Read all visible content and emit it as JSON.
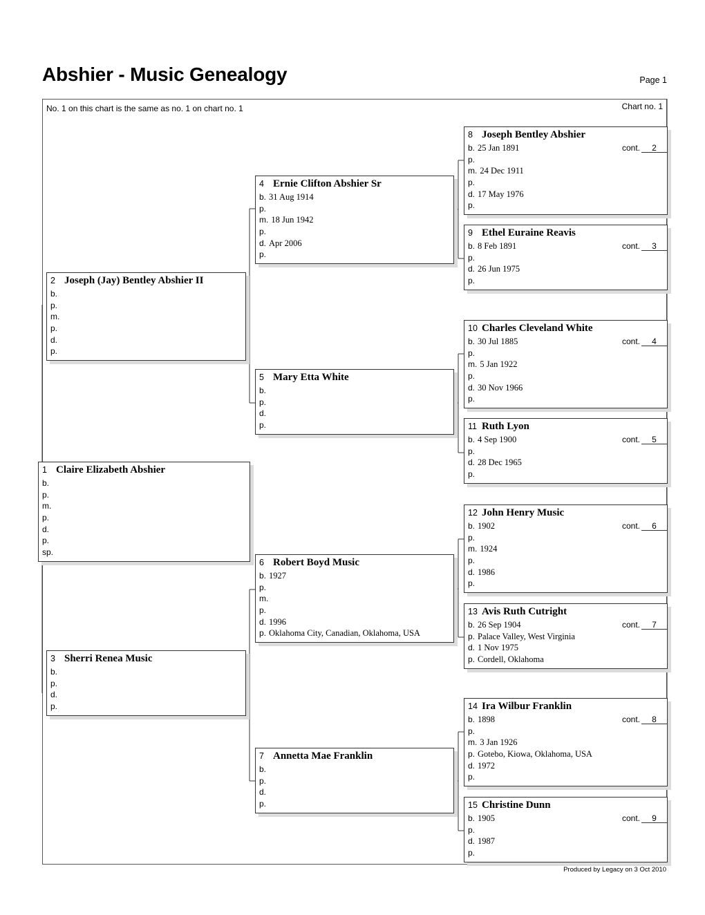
{
  "header": {
    "title": "Abshier - Music Genealogy",
    "page_label": "Page 1"
  },
  "chart": {
    "note": "No. 1 on this chart is the same as no. 1 on chart no. 1",
    "chart_no": "Chart no. 1"
  },
  "footer": "Produced by Legacy on 3 Oct 2010",
  "labels": {
    "cont": "cont."
  },
  "people": {
    "p1": {
      "num": "1",
      "name": "Claire Elizabeth Abshier",
      "rows": [
        {
          "l": "b.",
          "v": ""
        },
        {
          "l": "p.",
          "v": ""
        },
        {
          "l": "m.",
          "v": ""
        },
        {
          "l": "p.",
          "v": ""
        },
        {
          "l": "d.",
          "v": ""
        },
        {
          "l": "p.",
          "v": ""
        },
        {
          "l": "sp.",
          "v": ""
        }
      ]
    },
    "p2": {
      "num": "2",
      "name": "Joseph (Jay) Bentley Abshier II",
      "rows": [
        {
          "l": "b.",
          "v": ""
        },
        {
          "l": "p.",
          "v": ""
        },
        {
          "l": "m.",
          "v": ""
        },
        {
          "l": "p.",
          "v": ""
        },
        {
          "l": "d.",
          "v": ""
        },
        {
          "l": "p.",
          "v": ""
        }
      ]
    },
    "p3": {
      "num": "3",
      "name": "Sherri Renea Music",
      "rows": [
        {
          "l": "b.",
          "v": ""
        },
        {
          "l": "p.",
          "v": ""
        },
        {
          "l": "d.",
          "v": ""
        },
        {
          "l": "p.",
          "v": ""
        }
      ]
    },
    "p4": {
      "num": "4",
      "name": "Ernie Clifton Abshier Sr",
      "rows": [
        {
          "l": "b.",
          "v": "31 Aug 1914"
        },
        {
          "l": "p.",
          "v": ""
        },
        {
          "l": "m.",
          "v": "18 Jun 1942"
        },
        {
          "l": "p.",
          "v": ""
        },
        {
          "l": "d.",
          "v": "Apr 2006"
        },
        {
          "l": "p.",
          "v": ""
        }
      ]
    },
    "p5": {
      "num": "5",
      "name": "Mary Etta White",
      "rows": [
        {
          "l": "b.",
          "v": ""
        },
        {
          "l": "p.",
          "v": ""
        },
        {
          "l": "d.",
          "v": ""
        },
        {
          "l": "p.",
          "v": ""
        }
      ]
    },
    "p6": {
      "num": "6",
      "name": "Robert Boyd Music",
      "rows": [
        {
          "l": "b.",
          "v": "1927"
        },
        {
          "l": "p.",
          "v": ""
        },
        {
          "l": "m.",
          "v": ""
        },
        {
          "l": "p.",
          "v": ""
        },
        {
          "l": "d.",
          "v": "1996"
        },
        {
          "l": "p.",
          "v": "Oklahoma City, Canadian, Oklahoma, USA"
        }
      ]
    },
    "p7": {
      "num": "7",
      "name": "Annetta Mae Franklin",
      "rows": [
        {
          "l": "b.",
          "v": ""
        },
        {
          "l": "p.",
          "v": ""
        },
        {
          "l": "d.",
          "v": ""
        },
        {
          "l": "p.",
          "v": ""
        }
      ]
    },
    "p8": {
      "num": "8",
      "name": "Joseph Bentley Abshier",
      "cont": "2",
      "rows": [
        {
          "l": "b.",
          "v": "25 Jan 1891"
        },
        {
          "l": "p.",
          "v": ""
        },
        {
          "l": "m.",
          "v": "24 Dec 1911"
        },
        {
          "l": "p.",
          "v": ""
        },
        {
          "l": "d.",
          "v": "17 May 1976"
        },
        {
          "l": "p.",
          "v": ""
        }
      ]
    },
    "p9": {
      "num": "9",
      "name": "Ethel Euraine Reavis",
      "cont": "3",
      "rows": [
        {
          "l": "b.",
          "v": "8 Feb 1891"
        },
        {
          "l": "p.",
          "v": ""
        },
        {
          "l": "d.",
          "v": "26 Jun 1975"
        },
        {
          "l": "p.",
          "v": ""
        }
      ]
    },
    "p10": {
      "num": "10",
      "name": "Charles Cleveland White",
      "cont": "4",
      "rows": [
        {
          "l": "b.",
          "v": "30 Jul 1885"
        },
        {
          "l": "p.",
          "v": ""
        },
        {
          "l": "m.",
          "v": "5 Jan 1922"
        },
        {
          "l": "p.",
          "v": ""
        },
        {
          "l": "d.",
          "v": "30 Nov 1966"
        },
        {
          "l": "p.",
          "v": ""
        }
      ]
    },
    "p11": {
      "num": "11",
      "name": "Ruth Lyon",
      "cont": "5",
      "rows": [
        {
          "l": "b.",
          "v": "4 Sep 1900"
        },
        {
          "l": "p.",
          "v": ""
        },
        {
          "l": "d.",
          "v": "28 Dec 1965"
        },
        {
          "l": "p.",
          "v": ""
        }
      ]
    },
    "p12": {
      "num": "12",
      "name": "John Henry Music",
      "cont": "6",
      "rows": [
        {
          "l": "b.",
          "v": "1902"
        },
        {
          "l": "p.",
          "v": ""
        },
        {
          "l": "m.",
          "v": "1924"
        },
        {
          "l": "p.",
          "v": ""
        },
        {
          "l": "d.",
          "v": "1986"
        },
        {
          "l": "p.",
          "v": ""
        }
      ]
    },
    "p13": {
      "num": "13",
      "name": "Avis Ruth Cutright",
      "cont": "7",
      "rows": [
        {
          "l": "b.",
          "v": "26 Sep 1904"
        },
        {
          "l": "p.",
          "v": "Palace Valley, West Virginia"
        },
        {
          "l": "d.",
          "v": "1 Nov 1975"
        },
        {
          "l": "p.",
          "v": "Cordell, Oklahoma"
        }
      ]
    },
    "p14": {
      "num": "14",
      "name": "Ira Wilbur Franklin",
      "cont": "8",
      "rows": [
        {
          "l": "b.",
          "v": "1898"
        },
        {
          "l": "p.",
          "v": ""
        },
        {
          "l": "m.",
          "v": "3 Jan 1926"
        },
        {
          "l": "p.",
          "v": "Gotebo, Kiowa, Oklahoma, USA"
        },
        {
          "l": "d.",
          "v": "1972"
        },
        {
          "l": "p.",
          "v": ""
        }
      ]
    },
    "p15": {
      "num": "15",
      "name": "Christine Dunn",
      "cont": "9",
      "rows": [
        {
          "l": "b.",
          "v": "1905"
        },
        {
          "l": "p.",
          "v": ""
        },
        {
          "l": "d.",
          "v": "1987"
        },
        {
          "l": "p.",
          "v": ""
        }
      ]
    }
  }
}
